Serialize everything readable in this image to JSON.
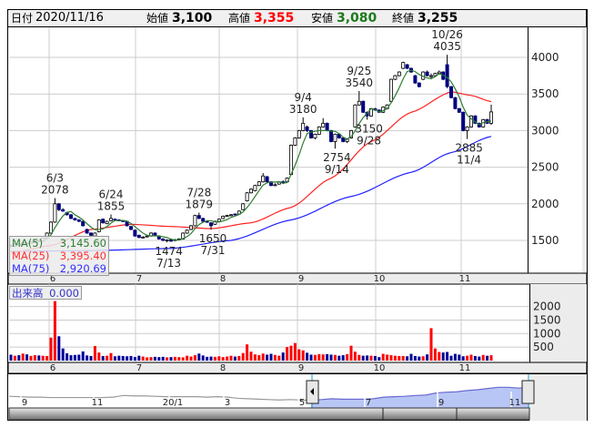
{
  "header": {
    "date_label": "日付",
    "date": "2020/11/16",
    "open_label": "始値",
    "open": "3,100",
    "high_label": "高値",
    "high": "3,355",
    "low_label": "安値",
    "low": "3,080",
    "close_label": "終値",
    "close": "3,255"
  },
  "colors": {
    "up_fill": "#ffffff",
    "down_fill": "#000080",
    "vol_up": "#ff0000",
    "vol_down": "#000099",
    "ma5": "#2e7d32",
    "ma25": "#ff2020",
    "ma75": "#2020ff",
    "high": "#ff0000",
    "low": "#1b7a1b"
  },
  "legend": {
    "ma5_label": "MA(5)",
    "ma5_value": "3,145.60",
    "ma25_label": "MA(25)",
    "ma25_value": "3,395.40",
    "ma75_label": "MA(75)",
    "ma75_value": "2,920.69"
  },
  "volume_legend": {
    "label": "出来高",
    "value": "0.000"
  },
  "chart_data": {
    "type": "candlestick",
    "price_axis": {
      "ticks": [
        "4000",
        "3500",
        "3000",
        "2500",
        "2000",
        "1500"
      ],
      "range": [
        1100,
        4400
      ]
    },
    "volume_axis": {
      "ticks": [
        "2000",
        "1500",
        "1000",
        "500"
      ]
    },
    "month_labels": [
      "6",
      "7",
      "8",
      "9",
      "10",
      "11"
    ],
    "month_start_index": [
      9,
      30,
      51,
      71,
      92,
      112
    ],
    "ohlc": [
      [
        1430,
        1450,
        1410,
        1420
      ],
      [
        1420,
        1460,
        1410,
        1450
      ],
      [
        1450,
        1460,
        1430,
        1440
      ],
      [
        1440,
        1480,
        1430,
        1470
      ],
      [
        1470,
        1480,
        1450,
        1460
      ],
      [
        1460,
        1490,
        1450,
        1480
      ],
      [
        1480,
        1510,
        1470,
        1500
      ],
      [
        1500,
        1510,
        1480,
        1490
      ],
      [
        1490,
        1540,
        1480,
        1530
      ],
      [
        1530,
        1610,
        1520,
        1600
      ],
      [
        1600,
        1760,
        1590,
        1750
      ],
      [
        1750,
        2078,
        1740,
        2000
      ],
      [
        2000,
        2010,
        1900,
        1920
      ],
      [
        1920,
        1940,
        1890,
        1900
      ],
      [
        1880,
        1890,
        1840,
        1850
      ],
      [
        1850,
        1860,
        1790,
        1800
      ],
      [
        1800,
        1810,
        1770,
        1780
      ],
      [
        1780,
        1790,
        1750,
        1760
      ],
      [
        1760,
        1770,
        1690,
        1700
      ],
      [
        1650,
        1660,
        1590,
        1600
      ],
      [
        1600,
        1610,
        1560,
        1570
      ],
      [
        1560,
        1610,
        1550,
        1600
      ],
      [
        1620,
        1790,
        1610,
        1780
      ],
      [
        1790,
        1800,
        1730,
        1740
      ],
      [
        1730,
        1770,
        1720,
        1760
      ],
      [
        1770,
        1855,
        1760,
        1800
      ],
      [
        1790,
        1800,
        1770,
        1780
      ],
      [
        1780,
        1790,
        1760,
        1770
      ],
      [
        1770,
        1780,
        1750,
        1760
      ],
      [
        1760,
        1770,
        1690,
        1700
      ],
      [
        1690,
        1700,
        1640,
        1650
      ],
      [
        1640,
        1650,
        1550,
        1560
      ],
      [
        1570,
        1580,
        1530,
        1540
      ],
      [
        1540,
        1560,
        1530,
        1545
      ],
      [
        1550,
        1570,
        1540,
        1560
      ],
      [
        1560,
        1610,
        1550,
        1600
      ],
      [
        1600,
        1610,
        1560,
        1570
      ],
      [
        1560,
        1570,
        1510,
        1520
      ],
      [
        1520,
        1530,
        1490,
        1500
      ],
      [
        1500,
        1515,
        1474,
        1505
      ],
      [
        1510,
        1520,
        1480,
        1490
      ],
      [
        1500,
        1520,
        1490,
        1510
      ],
      [
        1510,
        1530,
        1500,
        1520
      ],
      [
        1520,
        1610,
        1510,
        1600
      ],
      [
        1600,
        1650,
        1590,
        1640
      ],
      [
        1650,
        1710,
        1640,
        1700
      ],
      [
        1700,
        1850,
        1690,
        1840
      ],
      [
        1840,
        1879,
        1790,
        1800
      ],
      [
        1800,
        1810,
        1750,
        1760
      ],
      [
        1760,
        1770,
        1740,
        1750
      ],
      [
        1740,
        1750,
        1650,
        1700
      ],
      [
        1720,
        1770,
        1710,
        1760
      ],
      [
        1760,
        1800,
        1750,
        1790
      ],
      [
        1800,
        1840,
        1790,
        1830
      ],
      [
        1830,
        1850,
        1820,
        1840
      ],
      [
        1840,
        1860,
        1830,
        1850
      ],
      [
        1860,
        1870,
        1840,
        1850
      ],
      [
        1860,
        1910,
        1850,
        1900
      ],
      [
        1920,
        2010,
        1910,
        2000
      ],
      [
        2040,
        2160,
        2030,
        2150
      ],
      [
        2150,
        2210,
        2140,
        2200
      ],
      [
        2180,
        2260,
        2170,
        2250
      ],
      [
        2250,
        2310,
        2240,
        2300
      ],
      [
        2300,
        2420,
        2290,
        2380
      ],
      [
        2370,
        2380,
        2290,
        2300
      ],
      [
        2300,
        2310,
        2240,
        2250
      ],
      [
        2250,
        2280,
        2240,
        2260
      ],
      [
        2270,
        2310,
        2260,
        2300
      ],
      [
        2300,
        2320,
        2270,
        2290
      ],
      [
        2300,
        2360,
        2290,
        2350
      ],
      [
        2400,
        2810,
        2390,
        2800
      ],
      [
        2800,
        2910,
        2790,
        2900
      ],
      [
        2900,
        3010,
        2890,
        3000
      ],
      [
        3000,
        3180,
        2990,
        3100
      ],
      [
        3050,
        3070,
        2980,
        3000
      ],
      [
        3000,
        3010,
        2890,
        2900
      ],
      [
        2900,
        2960,
        2880,
        2950
      ],
      [
        2950,
        3060,
        2940,
        3050
      ],
      [
        3050,
        3170,
        3040,
        3100
      ],
      [
        3100,
        3110,
        2990,
        3000
      ],
      [
        3000,
        3010,
        2840,
        2850
      ],
      [
        2850,
        2960,
        2754,
        2950
      ],
      [
        2950,
        2960,
        2890,
        2900
      ],
      [
        2900,
        2910,
        2840,
        2850
      ],
      [
        2850,
        2890,
        2830,
        2880
      ],
      [
        2900,
        3010,
        2890,
        3000
      ],
      [
        3050,
        3360,
        3040,
        3350
      ],
      [
        3350,
        3540,
        3340,
        3400
      ],
      [
        3400,
        3410,
        3240,
        3250
      ],
      [
        3250,
        3260,
        3150,
        3200
      ],
      [
        3200,
        3310,
        3190,
        3300
      ],
      [
        3300,
        3310,
        3270,
        3280
      ],
      [
        3280,
        3290,
        3240,
        3250
      ],
      [
        3250,
        3330,
        3240,
        3320
      ],
      [
        3300,
        3360,
        3290,
        3350
      ],
      [
        3400,
        3710,
        3390,
        3700
      ],
      [
        3700,
        3760,
        3690,
        3750
      ],
      [
        3750,
        3810,
        3740,
        3800
      ],
      [
        3850,
        3940,
        3840,
        3930
      ],
      [
        3900,
        3910,
        3840,
        3850
      ],
      [
        3850,
        3860,
        3790,
        3800
      ],
      [
        3750,
        3760,
        3640,
        3650
      ],
      [
        3650,
        3660,
        3590,
        3600
      ],
      [
        3700,
        3810,
        3690,
        3800
      ],
      [
        3800,
        3820,
        3740,
        3750
      ],
      [
        3750,
        3780,
        3700,
        3750
      ],
      [
        3750,
        3790,
        3740,
        3780
      ],
      [
        3780,
        3820,
        3770,
        3800
      ],
      [
        3800,
        3810,
        3690,
        3700
      ],
      [
        3900,
        4035,
        3580,
        3600
      ],
      [
        3600,
        3610,
        3440,
        3450
      ],
      [
        3450,
        3460,
        3290,
        3300
      ],
      [
        3300,
        3310,
        3240,
        3250
      ],
      [
        3250,
        3260,
        2990,
        3000
      ],
      [
        3000,
        3060,
        2885,
        3050
      ],
      [
        3050,
        3210,
        3040,
        3200
      ],
      [
        3200,
        3210,
        3090,
        3100
      ],
      [
        3100,
        3110,
        3040,
        3050
      ],
      [
        3050,
        3160,
        3040,
        3150
      ],
      [
        3150,
        3160,
        3090,
        3100
      ],
      [
        3100,
        3355,
        3080,
        3255
      ]
    ],
    "volume": [
      220,
      180,
      200,
      260,
      230,
      170,
      200,
      190,
      180,
      170,
      850,
      2200,
      900,
      450,
      270,
      200,
      210,
      220,
      340,
      190,
      170,
      540,
      300,
      170,
      180,
      280,
      160,
      180,
      170,
      160,
      170,
      130,
      180,
      150,
      120,
      130,
      140,
      130,
      140,
      120,
      130,
      140,
      130,
      120,
      180,
      150,
      200,
      260,
      190,
      140,
      150,
      140,
      160,
      130,
      150,
      180,
      150,
      170,
      280,
      600,
      330,
      230,
      200,
      260,
      220,
      250,
      210,
      180,
      300,
      500,
      550,
      650,
      420,
      380,
      290,
      220,
      210,
      240,
      230,
      240,
      220,
      210,
      180,
      200,
      240,
      550,
      330,
      210,
      180,
      190,
      180,
      170,
      130,
      250,
      220,
      200,
      180,
      170,
      170,
      160,
      250,
      170,
      150,
      160,
      230,
      1200,
      450,
      320,
      300,
      320,
      180,
      250,
      220,
      160,
      180,
      220,
      170,
      150,
      210,
      180,
      200
    ],
    "ma25": [
      [
        0,
        1330
      ],
      [
        10,
        1430
      ],
      [
        20,
        1650
      ],
      [
        30,
        1720
      ],
      [
        40,
        1690
      ],
      [
        50,
        1660
      ],
      [
        60,
        1740
      ],
      [
        70,
        1950
      ],
      [
        80,
        2350
      ],
      [
        90,
        2850
      ],
      [
        100,
        3250
      ],
      [
        110,
        3530
      ],
      [
        115,
        3480
      ],
      [
        120,
        3395.4
      ]
    ],
    "ma75": [
      [
        0,
        1350
      ],
      [
        20,
        1360
      ],
      [
        40,
        1390
      ],
      [
        55,
        1500
      ],
      [
        70,
        1780
      ],
      [
        85,
        2100
      ],
      [
        100,
        2430
      ],
      [
        110,
        2700
      ],
      [
        120,
        2920.69
      ]
    ],
    "annotations": [
      {
        "i": 11,
        "date": "6/3",
        "value": "2078",
        "pos": "above"
      },
      {
        "i": 25,
        "date": "6/24",
        "value": "1855",
        "pos": "above"
      },
      {
        "i": 39,
        "date": "7/13",
        "value": "1474",
        "pos": "below"
      },
      {
        "i": 47,
        "date": "7/28",
        "value": "1879",
        "pos": "above"
      },
      {
        "i": 50,
        "date": "7/31",
        "value": "1650",
        "pos": "below"
      },
      {
        "i": 73,
        "date": "9/4",
        "value": "3180",
        "pos": "above"
      },
      {
        "i": 81,
        "date": "9/14",
        "value": "2754",
        "pos": "below"
      },
      {
        "i": 87,
        "date": "9/25",
        "value": "3540",
        "pos": "above"
      },
      {
        "i": 89,
        "date": "9/28",
        "value": "3150",
        "pos": "below"
      },
      {
        "i": 109,
        "date": "10/26",
        "value": "4035",
        "pos": "above"
      },
      {
        "i": 114,
        "date": "11/4",
        "value": "2885",
        "pos": "below"
      }
    ]
  },
  "navigator": {
    "labels": [
      "9",
      "11",
      "20/1",
      "3",
      "5",
      "7",
      "9",
      "11"
    ],
    "series": [
      2200,
      2150,
      2100,
      2100,
      2050,
      2050,
      2050,
      2050,
      2050,
      2050,
      2100,
      2300,
      2250,
      2250,
      2200,
      2150,
      2150,
      2150,
      2150,
      2100,
      2150,
      2100,
      1950,
      1900,
      1850,
      1800,
      1750,
      1800,
      1750,
      1700,
      1800,
      1900,
      1850,
      1850,
      1850,
      1900,
      2100,
      2150,
      2200,
      2300,
      2350,
      2600,
      2700,
      2750,
      2900,
      3000,
      3150,
      3300,
      3300,
      3200,
      3300
    ]
  }
}
